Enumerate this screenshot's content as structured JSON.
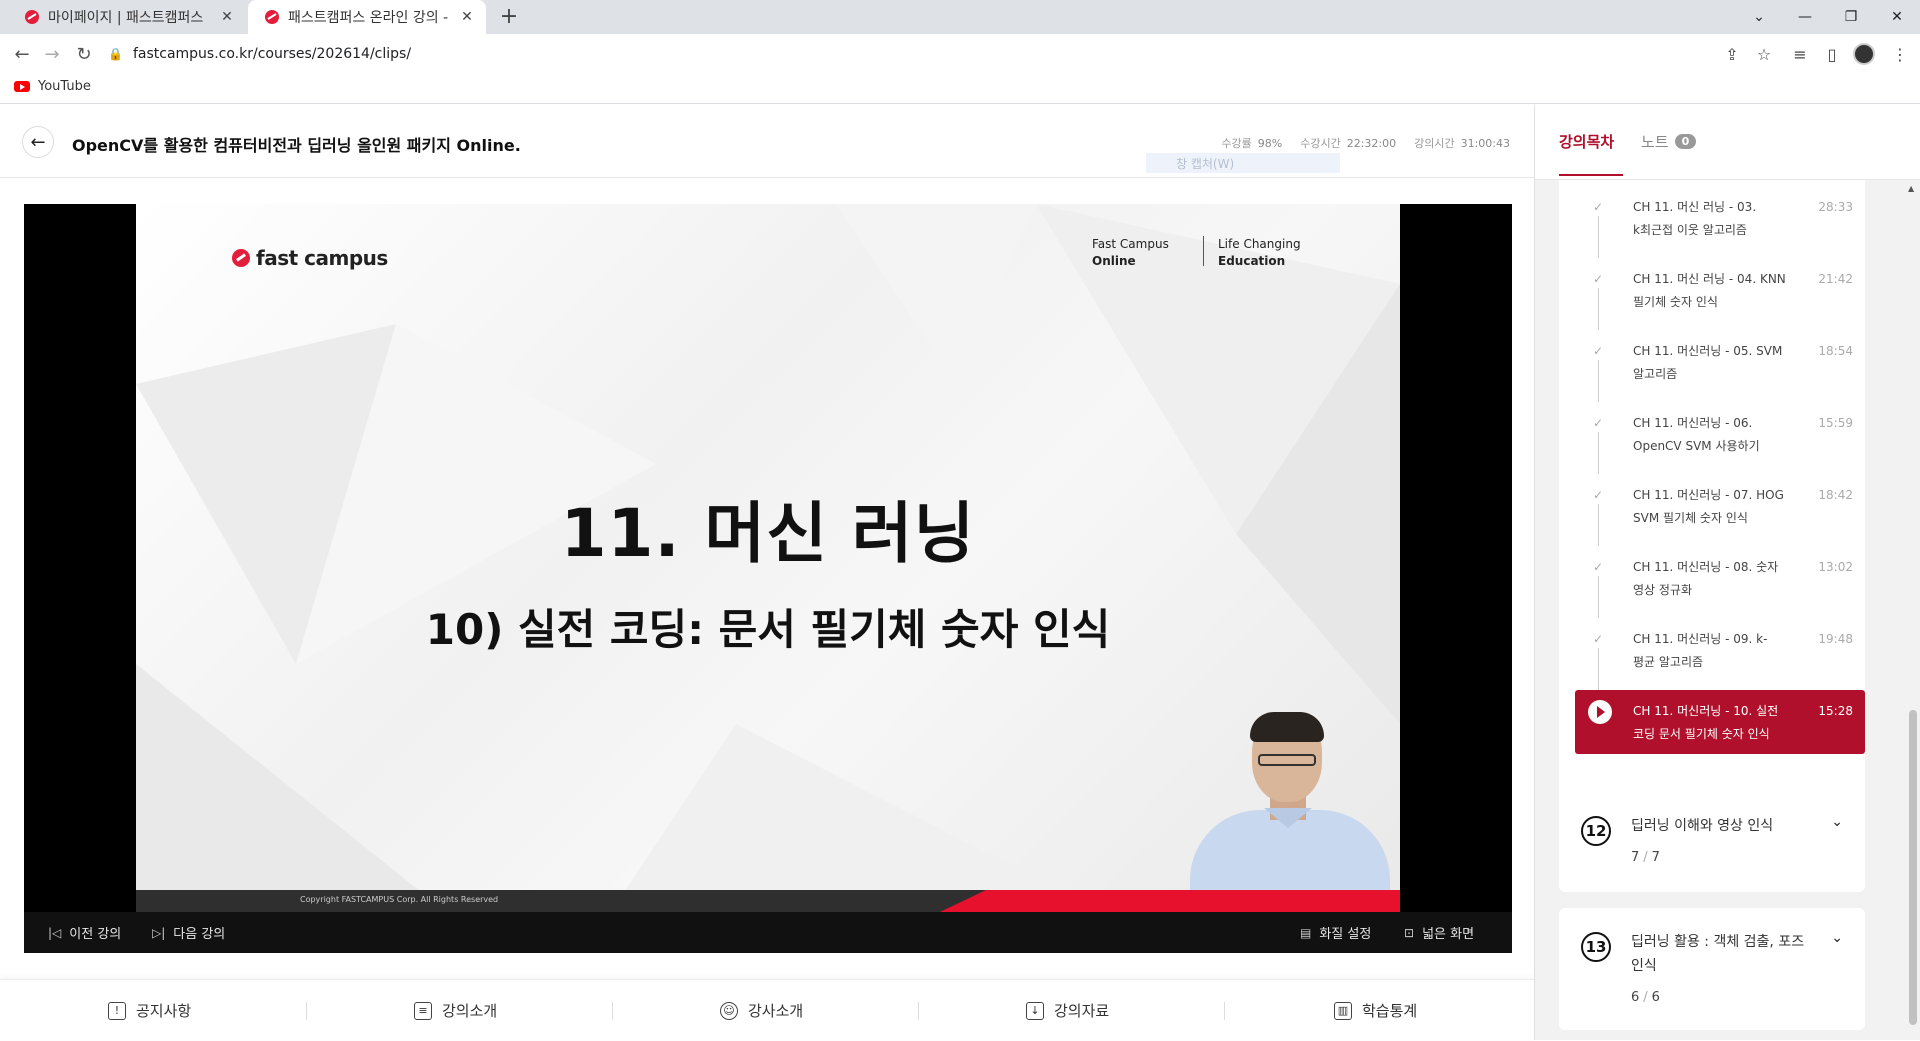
{
  "browser": {
    "tabs": [
      {
        "title": "마이페이지 | 패스트캠퍼스",
        "active": false
      },
      {
        "title": "패스트캠퍼스 온라인 강의 -",
        "active": true
      }
    ],
    "url": "fastcampus.co.kr/courses/202614/clips/",
    "bookmark": "YouTube"
  },
  "course": {
    "title": "OpenCV를 활용한 컴퓨터비전과 딥러닝 올인원 패키지 Online.",
    "stats": [
      {
        "label": "수강률",
        "value": "98%"
      },
      {
        "label": "수강시간",
        "value": "22:32:00"
      },
      {
        "label": "강의시간",
        "value": "31:00:43"
      }
    ],
    "ghost_text": "창 캡처(W)"
  },
  "slide": {
    "logo_text": "fast campus",
    "brand_line1": "Fast Campus",
    "brand_line2": "Online",
    "tag_line1": "Life Changing",
    "tag_line2": "Education",
    "title": "11. 머신 러닝",
    "subtitle": "10) 실전 코딩: 문서 필기체 숫자 인식",
    "copyright": "Copyright FASTCAMPUS Corp. All Rights Reserved"
  },
  "player_controls": {
    "prev": "이전 강의",
    "next": "다음 강의",
    "quality": "화질 설정",
    "wide": "넓은 화면"
  },
  "bottom_nav": [
    "공지사항",
    "강의소개",
    "강사소개",
    "강의자료",
    "학습통계"
  ],
  "sidebar": {
    "tab_toc": "강의목차",
    "tab_notes": "노트",
    "notes_count": "0",
    "clips": [
      {
        "line1": "CH 11. 머신 러닝 - 03.",
        "line2": "k최근접 이웃 알고리즘",
        "duration": "28:33"
      },
      {
        "line1": "CH 11. 머신 러닝 - 04. KNN",
        "line2": "필기체 숫자 인식",
        "duration": "21:42"
      },
      {
        "line1": "CH 11. 머신러닝 - 05. SVM",
        "line2": "알고리즘",
        "duration": "18:54"
      },
      {
        "line1": "CH 11. 머신러닝 - 06.",
        "line2": "OpenCV SVM 사용하기",
        "duration": "15:59"
      },
      {
        "line1": "CH 11. 머신러닝 - 07. HOG",
        "line2": "SVM 필기체 숫자 인식",
        "duration": "18:42"
      },
      {
        "line1": "CH 11. 머신러닝 - 08. 숫자",
        "line2": "영상 정규화",
        "duration": "13:02"
      },
      {
        "line1": "CH 11. 머신러닝 - 09. k-",
        "line2": "평균 알고리즘",
        "duration": "19:48"
      }
    ],
    "current_clip": {
      "line1": "CH 11. 머신러닝 - 10. 실전",
      "line2": "코딩 문서 필기체 숫자 인식",
      "duration": "15:28"
    },
    "chapters": [
      {
        "num": "12",
        "title": "딥러닝 이해와 영상 인식",
        "done": "7",
        "total": "7"
      },
      {
        "num": "13",
        "title": "딥러닝 활용 : 객체 검출, 포즈 인식",
        "done": "6",
        "total": "6"
      }
    ]
  },
  "colors": {
    "accent": "#b0102b",
    "brand_red": "#e31e3c"
  },
  "icons": [
    "back-arrow-icon",
    "play-icon",
    "check-icon",
    "chevron-down-icon",
    "prev-icon",
    "next-icon",
    "quality-icon",
    "wide-screen-icon",
    "notice-icon",
    "intro-icon",
    "instructor-icon",
    "material-icon",
    "stats-icon"
  ]
}
